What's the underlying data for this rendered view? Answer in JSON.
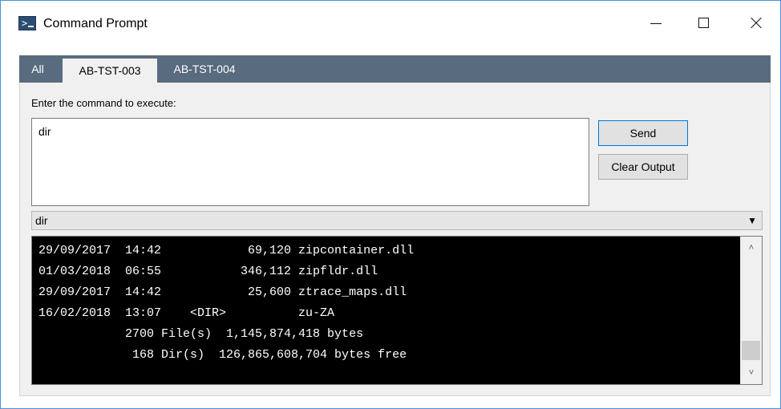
{
  "window": {
    "title": "Command Prompt",
    "icon": "console-icon"
  },
  "tabs": [
    {
      "label": "All"
    },
    {
      "label": "AB-TST-003",
      "active": true
    },
    {
      "label": "AB-TST-004"
    }
  ],
  "command": {
    "label": "Enter the command to execute:",
    "value": "dir"
  },
  "buttons": {
    "send": "Send",
    "clear": "Clear Output"
  },
  "history": {
    "selected": "dir"
  },
  "output": {
    "lines": [
      "29/09/2017  14:42            69,120 zipcontainer.dll",
      "01/03/2018  06:55           346,112 zipfldr.dll",
      "29/09/2017  14:42            25,600 ztrace_maps.dll",
      "16/02/2018  13:07    <DIR>          zu-ZA",
      "            2700 File(s)  1,145,874,418 bytes",
      "             168 Dir(s)  126,865,608,704 bytes free"
    ]
  },
  "colors": {
    "tabstrip": "#596b7e",
    "output_bg": "#000000",
    "output_fg": "#ffffff"
  }
}
